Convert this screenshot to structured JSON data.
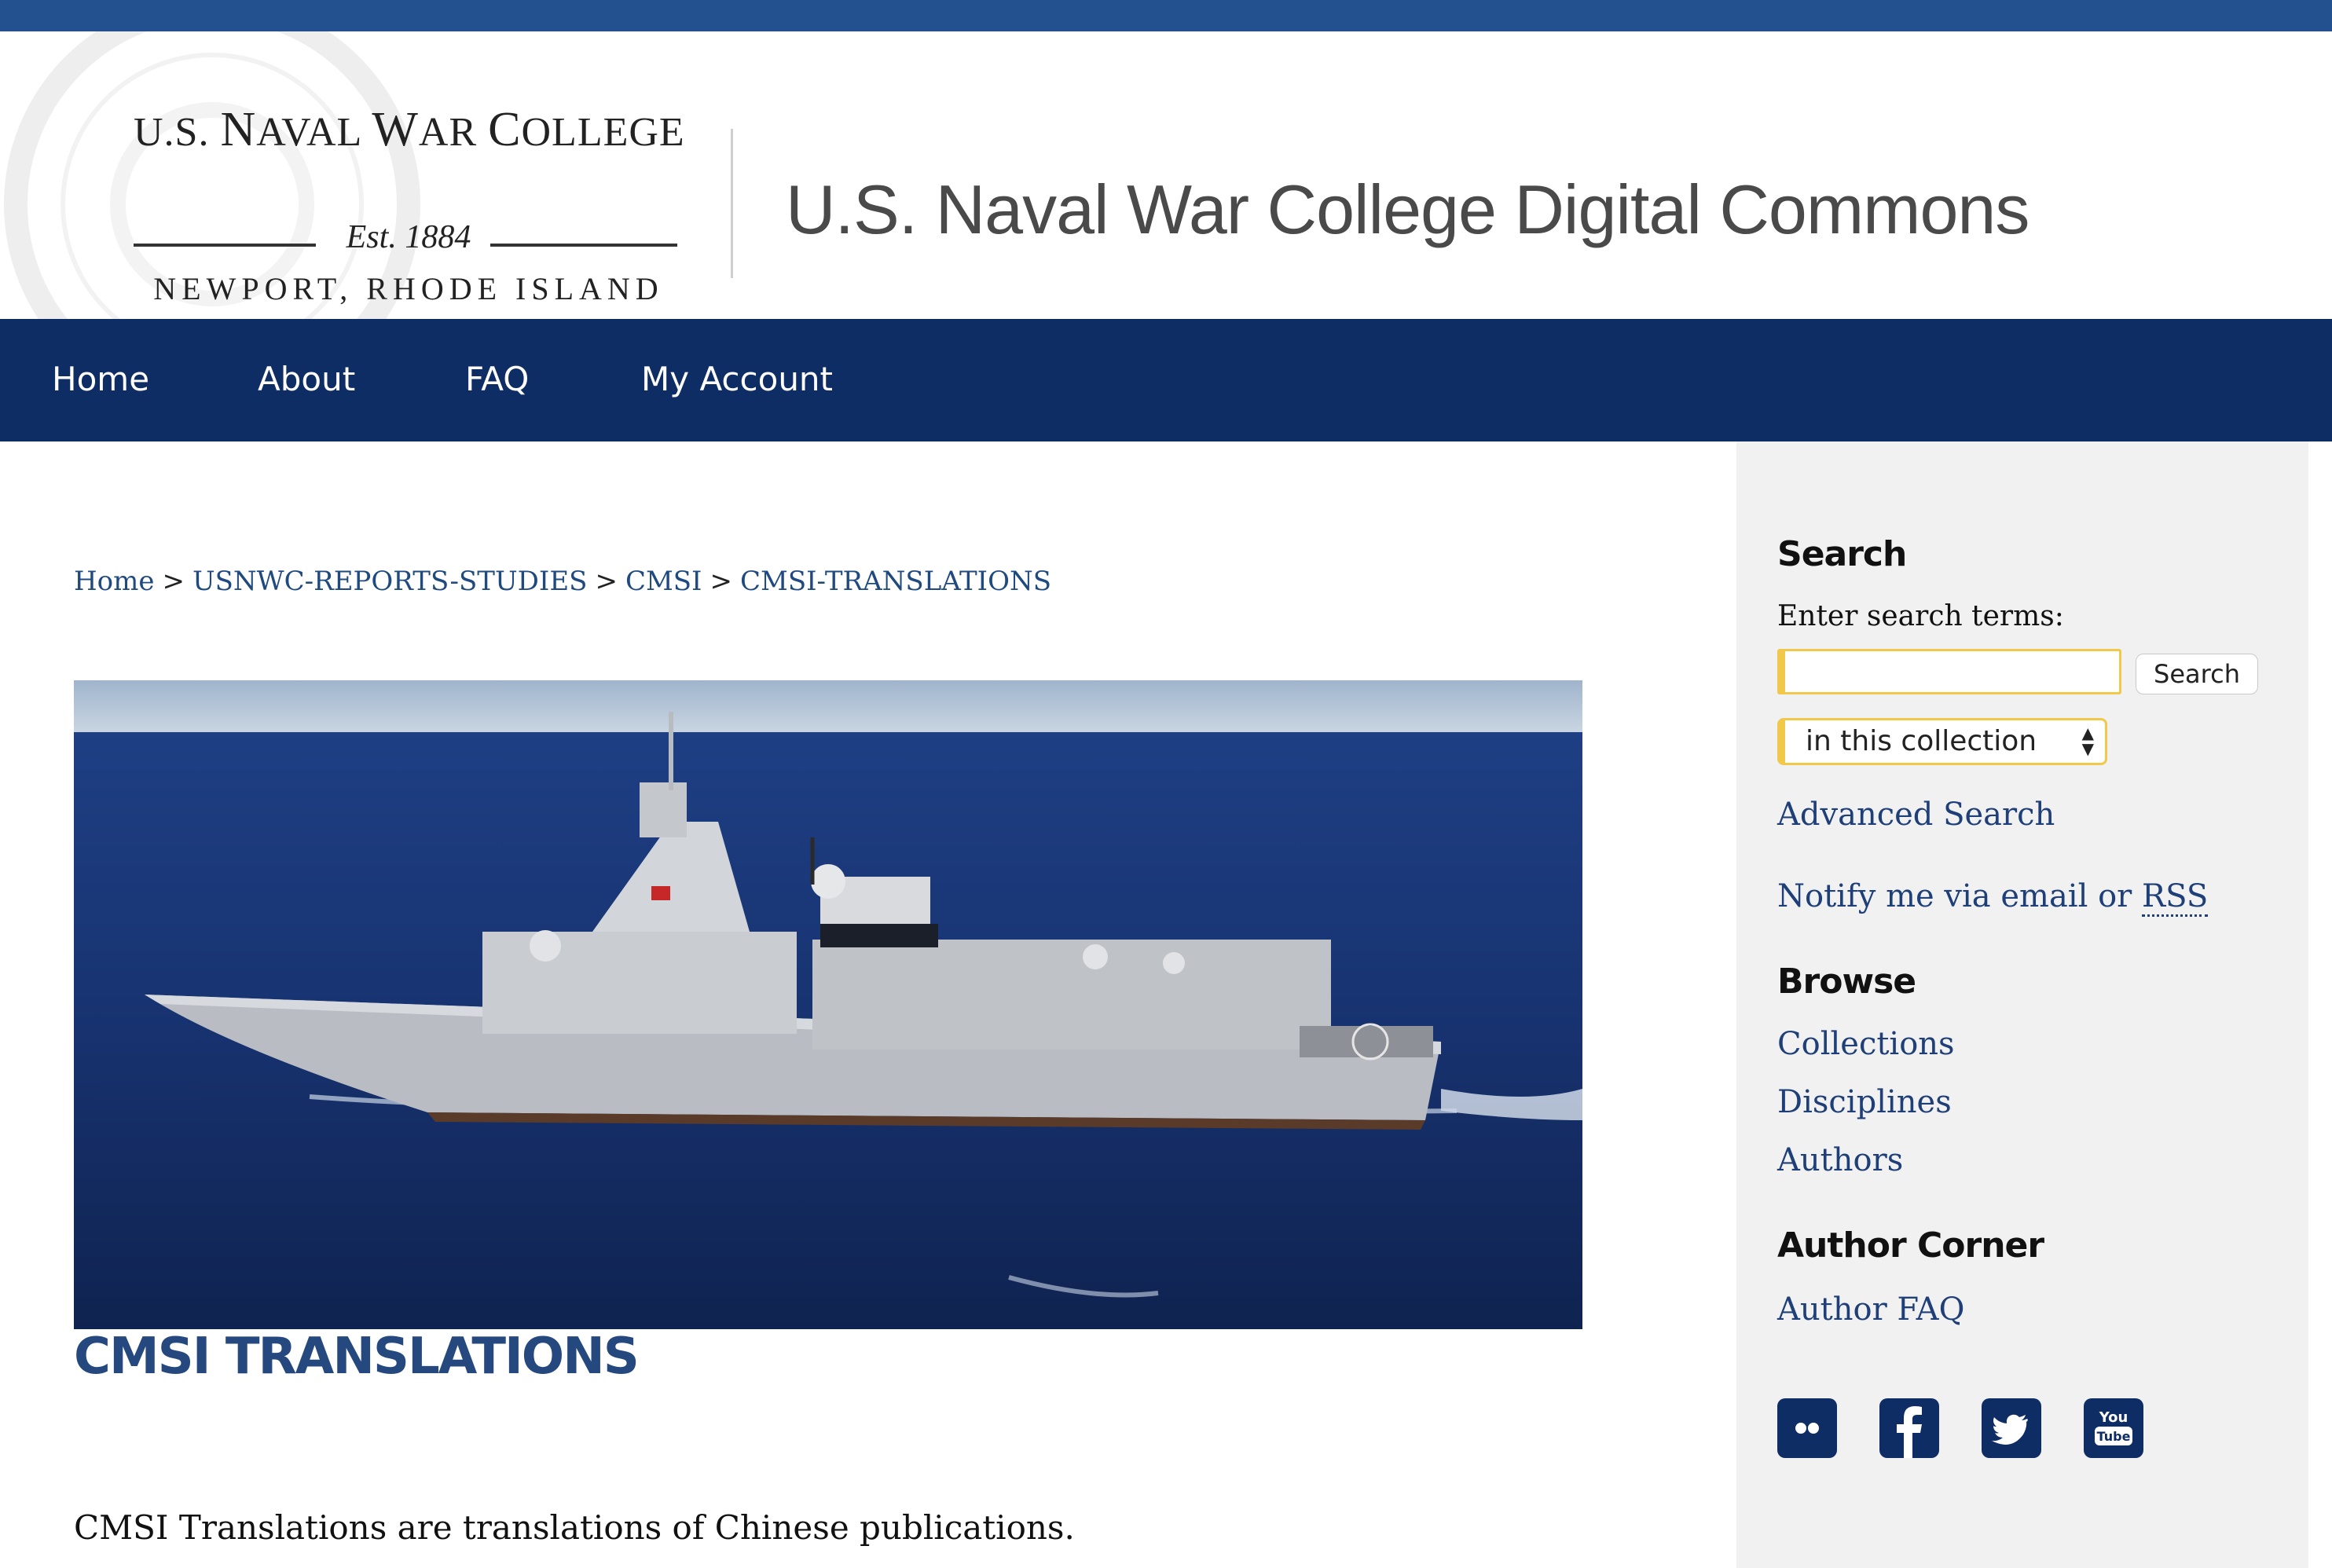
{
  "header": {
    "logo": {
      "line1_a": "U.S. ",
      "line1_b": "N",
      "line1_c": "AVAL ",
      "line1_d": "W",
      "line1_e": "AR ",
      "line1_f": "C",
      "line1_g": "OLLEGE",
      "est": "Est. 1884",
      "line3": "NEWPORT, RHODE ISLAND"
    },
    "site_title": "U.S. Naval War College Digital Commons"
  },
  "nav": {
    "items": [
      {
        "label": "Home"
      },
      {
        "label": "About"
      },
      {
        "label": "FAQ"
      },
      {
        "label": "My Account"
      }
    ]
  },
  "breadcrumb": {
    "items": [
      "Home",
      "USNWC-REPORTS-STUDIES",
      "CMSI",
      "CMSI-TRANSLATIONS"
    ],
    "separator": ">"
  },
  "main": {
    "title": "CMSI TRANSLATIONS",
    "description": "CMSI Translations are translations of Chinese publications."
  },
  "sidebar": {
    "search": {
      "heading": "Search",
      "label": "Enter search terms:",
      "input_value": "",
      "button_label": "Search",
      "scope_selected": "in this collection",
      "advanced_link": "Advanced Search",
      "notify_text": "Notify me via email or ",
      "rss_link": "RSS"
    },
    "browse": {
      "heading": "Browse",
      "links": [
        "Collections",
        "Disciplines",
        "Authors"
      ]
    },
    "author_corner": {
      "heading": "Author Corner",
      "links": [
        "Author FAQ"
      ]
    },
    "social": [
      {
        "icon": "flickr-icon"
      },
      {
        "icon": "facebook-icon"
      },
      {
        "icon": "twitter-icon"
      },
      {
        "icon": "youtube-icon",
        "text_a": "You",
        "text_b": "Tube"
      }
    ]
  },
  "colors": {
    "top_strip": "#23508f",
    "nav_bg": "#0f2d65",
    "link": "#1f3f78",
    "title": "#25497e",
    "sidebar_bg": "#f1f1f1",
    "focus_yellow": "#f1c84a"
  }
}
